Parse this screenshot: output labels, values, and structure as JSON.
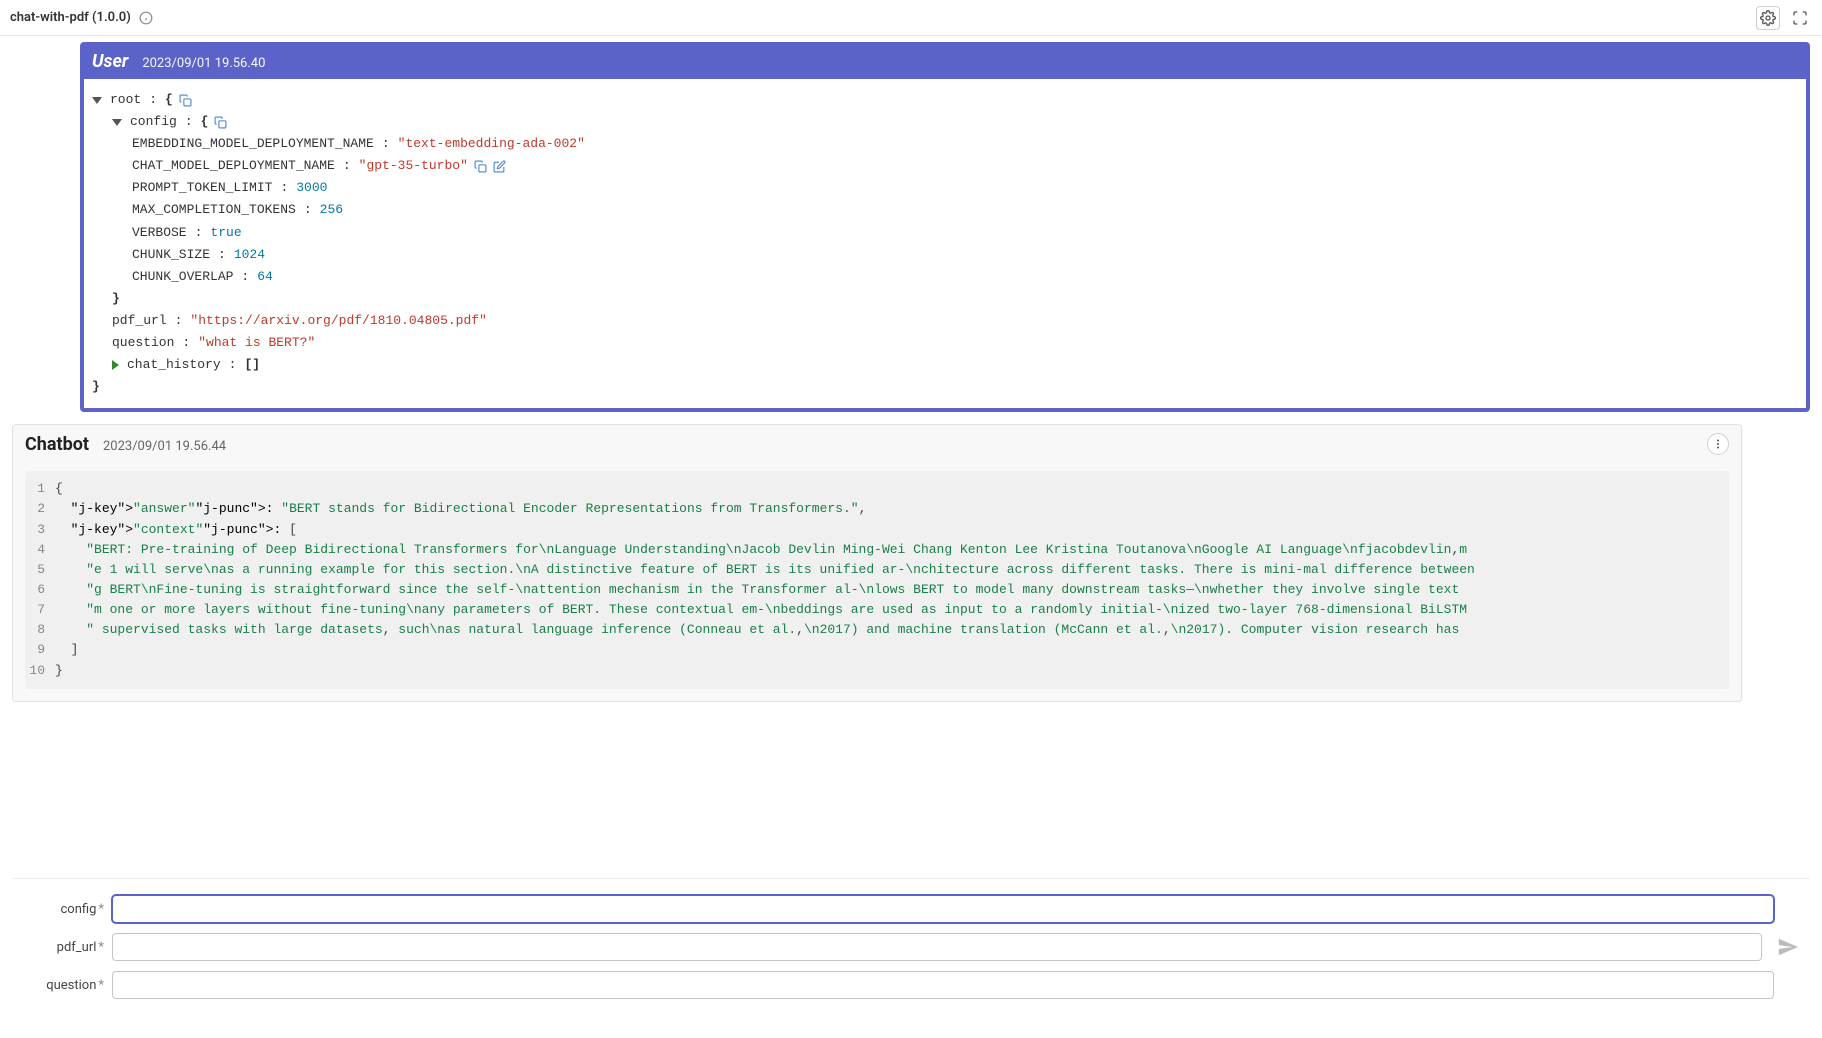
{
  "header": {
    "title": "chat-with-pdf (1.0.0)"
  },
  "user_msg": {
    "role": "User",
    "timestamp": "2023/09/01 19.56.40",
    "root_label": "root",
    "config_label": "config",
    "fields": {
      "embedding_model_key": "EMBEDDING_MODEL_DEPLOYMENT_NAME",
      "embedding_model_val": "\"text-embedding-ada-002\"",
      "chat_model_key": "CHAT_MODEL_DEPLOYMENT_NAME",
      "chat_model_val": "\"gpt-35-turbo\"",
      "prompt_limit_key": "PROMPT_TOKEN_LIMIT",
      "prompt_limit_val": "3000",
      "max_comp_key": "MAX_COMPLETION_TOKENS",
      "max_comp_val": "256",
      "verbose_key": "VERBOSE",
      "verbose_val": "true",
      "chunk_size_key": "CHUNK_SIZE",
      "chunk_size_val": "1024",
      "chunk_overlap_key": "CHUNK_OVERLAP",
      "chunk_overlap_val": "64"
    },
    "pdf_url_key": "pdf_url",
    "pdf_url_val": "\"https://arxiv.org/pdf/1810.04805.pdf\"",
    "question_key": "question",
    "question_val": "\"what is BERT?\"",
    "chat_history_key": "chat_history",
    "chat_history_val": "[]"
  },
  "bot_msg": {
    "role": "Chatbot",
    "timestamp": "2023/09/01 19.56.44",
    "lines": [
      {
        "n": "1",
        "raw": "{"
      },
      {
        "n": "2",
        "raw": "  \"answer\": \"BERT stands for Bidirectional Encoder Representations from Transformers.\","
      },
      {
        "n": "3",
        "raw": "  \"context\": ["
      },
      {
        "n": "4",
        "raw": "    \"BERT: Pre-training of Deep Bidirectional Transformers for\\nLanguage Understanding\\nJacob Devlin Ming-Wei Chang Kenton Lee Kristina Toutanova\\nGoogle AI Language\\nfjacobdevlin,m"
      },
      {
        "n": "5",
        "raw": "    \"e 1 will serve\\nas a running example for this section.\\nA distinctive feature of BERT is its unified ar-\\nchitecture across different tasks. There is mini-mal difference between"
      },
      {
        "n": "6",
        "raw": "    \"g BERT\\nFine-tuning is straightforward since the self-\\nattention mechanism in the Transformer al-\\nlows BERT to model many downstream tasks—\\nwhether they involve single text "
      },
      {
        "n": "7",
        "raw": "    \"m one or more layers without fine-tuning\\nany parameters of BERT. These contextual em-\\nbeddings are used as input to a randomly initial-\\nized two-layer 768-dimensional BiLSTM"
      },
      {
        "n": "8",
        "raw": "    \" supervised tasks with large datasets, such\\nas natural language inference (Conneau et al.,\\n2017) and machine translation (McCann et al.,\\n2017). Computer vision research has "
      },
      {
        "n": "9",
        "raw": "  ]"
      },
      {
        "n": "10",
        "raw": "}"
      }
    ]
  },
  "inputs": {
    "config_label": "config",
    "pdf_url_label": "pdf_url",
    "question_label": "question",
    "required_mark": "*"
  }
}
